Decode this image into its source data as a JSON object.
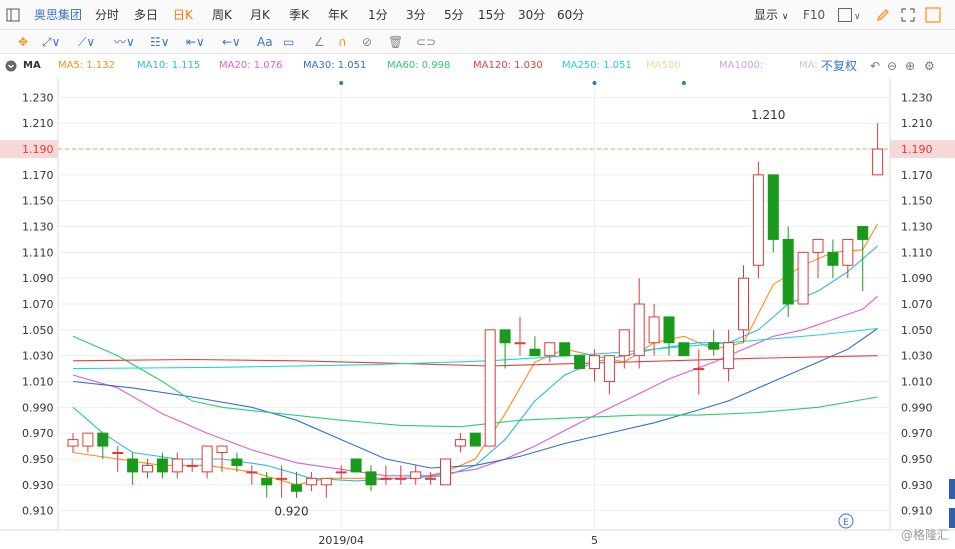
{
  "topbar": {
    "stock_name": "奥思集团",
    "periods": [
      "分时",
      "多日",
      "日K",
      "周K",
      "月K",
      "季K",
      "年K",
      "1分",
      "3分",
      "5分",
      "15分",
      "30分",
      "60分"
    ],
    "active_period": "日K",
    "display_label": "显示",
    "f10_label": "F10"
  },
  "ma_bar": {
    "label": "MA",
    "items": [
      {
        "text": "MA5: 1.132",
        "color": "#ff8c1a"
      },
      {
        "text": "MA10: 1.115",
        "color": "#33b5e5"
      },
      {
        "text": "MA20: 1.076",
        "color": "#e45bd1"
      },
      {
        "text": "MA30: 1.051",
        "color": "#2f6fd6"
      },
      {
        "text": "MA60: 0.998",
        "color": "#2ecc71"
      },
      {
        "text": "MA120: 1.030",
        "color": "#e04040"
      },
      {
        "text": "MA250: 1.051",
        "color": "#1fd6d6"
      },
      {
        "text": "MA500",
        "color": "#f2d7a0"
      },
      {
        "text": "MA1000:",
        "color": "#c9a8e8"
      },
      {
        "text": "MA:",
        "color": "#c8c8c8"
      }
    ],
    "adjust_label": "不复权"
  },
  "colors": {
    "up": "#e03a3a",
    "down": "#1a9a1a",
    "grid": "#eeeeee",
    "price_line": "#f0a060"
  },
  "chart_data": {
    "type": "candlestick",
    "y_ticks": [
      1.23,
      1.21,
      1.19,
      1.17,
      1.15,
      1.13,
      1.11,
      1.09,
      1.07,
      1.05,
      1.03,
      1.01,
      0.99,
      0.97,
      0.95,
      0.93,
      0.91
    ],
    "ylim": [
      0.895,
      1.245
    ],
    "x_labels": [
      {
        "label": "2019/04",
        "index": 18
      },
      {
        "label": "5",
        "index": 35
      }
    ],
    "current_price": "1.190",
    "high_annotation": {
      "label": "1.210",
      "index": 48,
      "value": 1.21
    },
    "low_annotation": {
      "label": "0.920",
      "index": 15,
      "value": 0.92
    },
    "candles": [
      {
        "o": 0.96,
        "h": 0.97,
        "l": 0.955,
        "c": 0.965
      },
      {
        "o": 0.96,
        "h": 0.97,
        "l": 0.955,
        "c": 0.97
      },
      {
        "o": 0.97,
        "h": 0.97,
        "l": 0.95,
        "c": 0.96
      },
      {
        "o": 0.955,
        "h": 0.96,
        "l": 0.94,
        "c": 0.955
      },
      {
        "o": 0.95,
        "h": 0.955,
        "l": 0.93,
        "c": 0.94
      },
      {
        "o": 0.94,
        "h": 0.95,
        "l": 0.935,
        "c": 0.945
      },
      {
        "o": 0.95,
        "h": 0.955,
        "l": 0.935,
        "c": 0.94
      },
      {
        "o": 0.94,
        "h": 0.955,
        "l": 0.935,
        "c": 0.95
      },
      {
        "o": 0.945,
        "h": 0.95,
        "l": 0.94,
        "c": 0.945
      },
      {
        "o": 0.94,
        "h": 0.96,
        "l": 0.935,
        "c": 0.96
      },
      {
        "o": 0.955,
        "h": 0.96,
        "l": 0.94,
        "c": 0.96
      },
      {
        "o": 0.95,
        "h": 0.955,
        "l": 0.94,
        "c": 0.945
      },
      {
        "o": 0.94,
        "h": 0.945,
        "l": 0.93,
        "c": 0.94
      },
      {
        "o": 0.935,
        "h": 0.94,
        "l": 0.92,
        "c": 0.93
      },
      {
        "o": 0.935,
        "h": 0.945,
        "l": 0.92,
        "c": 0.935
      },
      {
        "o": 0.93,
        "h": 0.94,
        "l": 0.92,
        "c": 0.925
      },
      {
        "o": 0.93,
        "h": 0.94,
        "l": 0.925,
        "c": 0.935
      },
      {
        "o": 0.93,
        "h": 0.935,
        "l": 0.92,
        "c": 0.935
      },
      {
        "o": 0.94,
        "h": 0.945,
        "l": 0.935,
        "c": 0.94
      },
      {
        "o": 0.95,
        "h": 0.95,
        "l": 0.94,
        "c": 0.94
      },
      {
        "o": 0.94,
        "h": 0.945,
        "l": 0.925,
        "c": 0.93
      },
      {
        "o": 0.935,
        "h": 0.945,
        "l": 0.93,
        "c": 0.935
      },
      {
        "o": 0.935,
        "h": 0.945,
        "l": 0.93,
        "c": 0.935
      },
      {
        "o": 0.935,
        "h": 0.945,
        "l": 0.93,
        "c": 0.94
      },
      {
        "o": 0.935,
        "h": 0.94,
        "l": 0.93,
        "c": 0.935
      },
      {
        "o": 0.93,
        "h": 0.95,
        "l": 0.93,
        "c": 0.95
      },
      {
        "o": 0.96,
        "h": 0.97,
        "l": 0.955,
        "c": 0.965
      },
      {
        "o": 0.97,
        "h": 0.97,
        "l": 0.96,
        "c": 0.96
      },
      {
        "o": 0.96,
        "h": 1.05,
        "l": 0.96,
        "c": 1.05
      },
      {
        "o": 1.05,
        "h": 1.05,
        "l": 1.02,
        "c": 1.04
      },
      {
        "o": 1.04,
        "h": 1.06,
        "l": 1.03,
        "c": 1.04
      },
      {
        "o": 1.035,
        "h": 1.045,
        "l": 1.03,
        "c": 1.03
      },
      {
        "o": 1.03,
        "h": 1.04,
        "l": 1.025,
        "c": 1.04
      },
      {
        "o": 1.04,
        "h": 1.04,
        "l": 1.03,
        "c": 1.03
      },
      {
        "o": 1.03,
        "h": 1.03,
        "l": 1.02,
        "c": 1.02
      },
      {
        "o": 1.02,
        "h": 1.035,
        "l": 1.01,
        "c": 1.03
      },
      {
        "o": 1.01,
        "h": 1.03,
        "l": 1.0,
        "c": 1.03
      },
      {
        "o": 1.03,
        "h": 1.05,
        "l": 1.02,
        "c": 1.05
      },
      {
        "o": 1.03,
        "h": 1.09,
        "l": 1.02,
        "c": 1.07
      },
      {
        "o": 1.04,
        "h": 1.07,
        "l": 1.03,
        "c": 1.06
      },
      {
        "o": 1.06,
        "h": 1.06,
        "l": 1.03,
        "c": 1.04
      },
      {
        "o": 1.04,
        "h": 1.04,
        "l": 1.03,
        "c": 1.03
      },
      {
        "o": 1.02,
        "h": 1.035,
        "l": 1.0,
        "c": 1.02
      },
      {
        "o": 1.04,
        "h": 1.05,
        "l": 1.03,
        "c": 1.035
      },
      {
        "o": 1.02,
        "h": 1.05,
        "l": 1.01,
        "c": 1.04
      },
      {
        "o": 1.05,
        "h": 1.1,
        "l": 1.04,
        "c": 1.09
      },
      {
        "o": 1.1,
        "h": 1.18,
        "l": 1.09,
        "c": 1.17
      },
      {
        "o": 1.17,
        "h": 1.17,
        "l": 1.11,
        "c": 1.12
      },
      {
        "o": 1.12,
        "h": 1.13,
        "l": 1.06,
        "c": 1.07
      },
      {
        "o": 1.07,
        "h": 1.11,
        "l": 1.07,
        "c": 1.11
      },
      {
        "o": 1.11,
        "h": 1.12,
        "l": 1.09,
        "c": 1.12
      },
      {
        "o": 1.11,
        "h": 1.12,
        "l": 1.09,
        "c": 1.1
      },
      {
        "o": 1.1,
        "h": 1.12,
        "l": 1.09,
        "c": 1.12
      },
      {
        "o": 1.13,
        "h": 1.13,
        "l": 1.08,
        "c": 1.12
      },
      {
        "o": 1.17,
        "h": 1.21,
        "l": 1.17,
        "c": 1.19
      }
    ],
    "ma_series": [
      {
        "name": "MA5",
        "color": "#ff8c1a",
        "points": [
          [
            0,
            0.955
          ],
          [
            3,
            0.95
          ],
          [
            6,
            0.945
          ],
          [
            9,
            0.945
          ],
          [
            12,
            0.94
          ],
          [
            15,
            0.93
          ],
          [
            17,
            0.935
          ],
          [
            19,
            0.935
          ],
          [
            21,
            0.935
          ],
          [
            23,
            0.935
          ],
          [
            25,
            0.94
          ],
          [
            27,
            0.95
          ],
          [
            29,
            0.985
          ],
          [
            31,
            1.025
          ],
          [
            33,
            1.035
          ],
          [
            35,
            1.03
          ],
          [
            37,
            1.025
          ],
          [
            39,
            1.04
          ],
          [
            41,
            1.045
          ],
          [
            43,
            1.035
          ],
          [
            45,
            1.04
          ],
          [
            47,
            1.085
          ],
          [
            49,
            1.1
          ],
          [
            51,
            1.11
          ],
          [
            53,
            1.112
          ],
          [
            54,
            1.132
          ]
        ]
      },
      {
        "name": "MA10",
        "color": "#33b5e5",
        "points": [
          [
            0,
            0.99
          ],
          [
            2,
            0.97
          ],
          [
            4,
            0.955
          ],
          [
            7,
            0.95
          ],
          [
            10,
            0.95
          ],
          [
            13,
            0.945
          ],
          [
            16,
            0.935
          ],
          [
            19,
            0.933
          ],
          [
            22,
            0.935
          ],
          [
            25,
            0.937
          ],
          [
            27,
            0.945
          ],
          [
            29,
            0.965
          ],
          [
            31,
            0.995
          ],
          [
            33,
            1.015
          ],
          [
            35,
            1.025
          ],
          [
            37,
            1.03
          ],
          [
            39,
            1.035
          ],
          [
            42,
            1.04
          ],
          [
            44,
            1.04
          ],
          [
            46,
            1.05
          ],
          [
            48,
            1.07
          ],
          [
            50,
            1.08
          ],
          [
            52,
            1.095
          ],
          [
            54,
            1.115
          ]
        ]
      },
      {
        "name": "MA20",
        "color": "#e45bd1",
        "points": [
          [
            0,
            1.015
          ],
          [
            3,
            1.005
          ],
          [
            6,
            0.985
          ],
          [
            9,
            0.97
          ],
          [
            12,
            0.957
          ],
          [
            15,
            0.947
          ],
          [
            18,
            0.942
          ],
          [
            21,
            0.937
          ],
          [
            24,
            0.937
          ],
          [
            27,
            0.942
          ],
          [
            29,
            0.95
          ],
          [
            31,
            0.96
          ],
          [
            34,
            0.978
          ],
          [
            37,
            0.995
          ],
          [
            40,
            1.012
          ],
          [
            43,
            1.025
          ],
          [
            45,
            1.035
          ],
          [
            47,
            1.045
          ],
          [
            49,
            1.05
          ],
          [
            51,
            1.058
          ],
          [
            53,
            1.066
          ],
          [
            54,
            1.076
          ]
        ]
      },
      {
        "name": "MA30",
        "color": "#2f6fd6",
        "points": [
          [
            0,
            1.01
          ],
          [
            4,
            1.005
          ],
          [
            8,
            0.998
          ],
          [
            12,
            0.99
          ],
          [
            15,
            0.98
          ],
          [
            18,
            0.965
          ],
          [
            21,
            0.95
          ],
          [
            24,
            0.943
          ],
          [
            27,
            0.945
          ],
          [
            30,
            0.952
          ],
          [
            33,
            0.962
          ],
          [
            36,
            0.97
          ],
          [
            39,
            0.978
          ],
          [
            42,
            0.988
          ],
          [
            44,
            0.995
          ],
          [
            46,
            1.005
          ],
          [
            48,
            1.015
          ],
          [
            50,
            1.025
          ],
          [
            52,
            1.035
          ],
          [
            54,
            1.051
          ]
        ]
      },
      {
        "name": "MA60",
        "color": "#2ecc71",
        "points": [
          [
            0,
            1.045
          ],
          [
            3,
            1.03
          ],
          [
            6,
            1.01
          ],
          [
            8,
            0.995
          ],
          [
            10,
            0.99
          ],
          [
            14,
            0.985
          ],
          [
            18,
            0.98
          ],
          [
            22,
            0.976
          ],
          [
            26,
            0.975
          ],
          [
            30,
            0.98
          ],
          [
            34,
            0.982
          ],
          [
            38,
            0.984
          ],
          [
            42,
            0.984
          ],
          [
            46,
            0.986
          ],
          [
            50,
            0.99
          ],
          [
            54,
            0.998
          ]
        ]
      },
      {
        "name": "MA120",
        "color": "#e04040",
        "points": [
          [
            0,
            1.026
          ],
          [
            8,
            1.027
          ],
          [
            15,
            1.026
          ],
          [
            22,
            1.024
          ],
          [
            28,
            1.022
          ],
          [
            34,
            1.024
          ],
          [
            40,
            1.026
          ],
          [
            46,
            1.028
          ],
          [
            54,
            1.03
          ]
        ]
      },
      {
        "name": "MA250",
        "color": "#1fd6d6",
        "points": [
          [
            0,
            1.02
          ],
          [
            10,
            1.021
          ],
          [
            20,
            1.023
          ],
          [
            28,
            1.026
          ],
          [
            36,
            1.032
          ],
          [
            44,
            1.04
          ],
          [
            50,
            1.046
          ],
          [
            54,
            1.051
          ]
        ]
      }
    ],
    "top_markers": [
      18,
      35,
      41
    ]
  }
}
